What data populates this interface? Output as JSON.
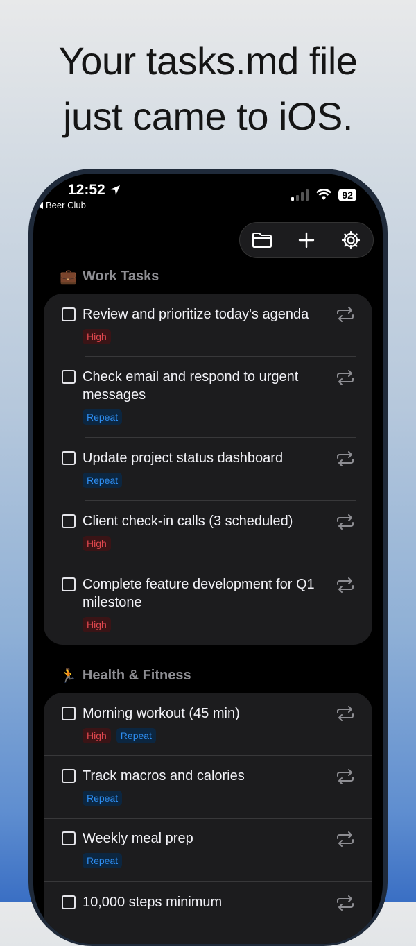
{
  "headline": {
    "line1": "Your tasks.md file",
    "line2": "just came to iOS."
  },
  "status_bar": {
    "time": "12:52",
    "back_label": "Beer Club",
    "battery": "92"
  },
  "sections": [
    {
      "emoji": "💼",
      "title": "Work Tasks",
      "tasks": [
        {
          "text": "Review and prioritize today's agenda",
          "tags": [
            "High"
          ]
        },
        {
          "text": "Check email and respond to urgent messages",
          "tags": [
            "Repeat"
          ]
        },
        {
          "text": "Update project status dashboard",
          "tags": [
            "Repeat"
          ]
        },
        {
          "text": "Client check-in calls (3 scheduled)",
          "tags": [
            "High"
          ]
        },
        {
          "text": "Complete feature development for Q1 milestone",
          "tags": [
            "High"
          ]
        }
      ]
    },
    {
      "emoji": "🏃",
      "title": "Health & Fitness",
      "tasks": [
        {
          "text": "Morning workout (45 min)",
          "tags": [
            "High",
            "Repeat"
          ]
        },
        {
          "text": "Track macros and calories",
          "tags": [
            "Repeat"
          ]
        },
        {
          "text": "Weekly meal prep",
          "tags": [
            "Repeat"
          ]
        },
        {
          "text": "10,000 steps minimum",
          "tags": []
        }
      ]
    }
  ],
  "colors": {
    "high": "#e0474e",
    "repeat": "#2e8df0",
    "card": "#1c1c1e"
  }
}
